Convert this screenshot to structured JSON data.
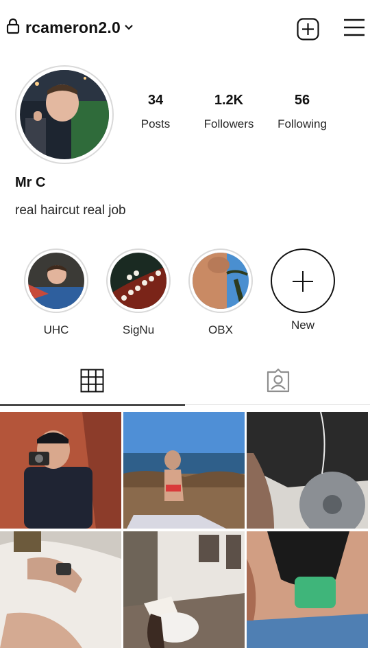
{
  "header": {
    "username": "rcameron2.0",
    "icons": [
      "lock-icon",
      "chevron-down-icon",
      "add-post-icon",
      "menu-icon"
    ]
  },
  "profile": {
    "display_name": "Mr C",
    "bio": "real haircut real job",
    "stats": [
      {
        "value": "34",
        "label": "Posts"
      },
      {
        "value": "1.2K",
        "label": "Followers"
      },
      {
        "value": "56",
        "label": "Following"
      }
    ]
  },
  "highlights": [
    {
      "label": "UHC"
    },
    {
      "label": "SigNu"
    },
    {
      "label": "OBX"
    },
    {
      "label": "New"
    }
  ],
  "tabs": [
    "grid-icon",
    "tagged-icon"
  ],
  "colors": {
    "text": "#111111",
    "ring": "#d9d9d9",
    "divider": "#e5e5e5"
  }
}
